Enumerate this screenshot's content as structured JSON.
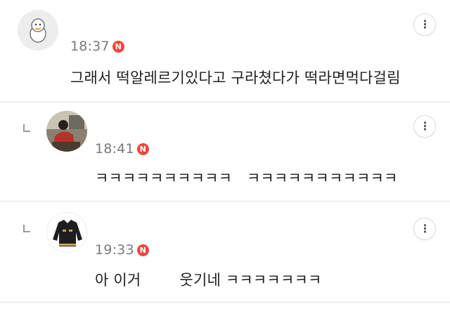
{
  "comments": [
    {
      "time": "18:37",
      "badge": "N",
      "text": "그래서 떡알레르기있다고 구라쳤다가 떡라면먹다걸림",
      "is_reply": false,
      "avatar": "cartoon-character"
    },
    {
      "time": "18:41",
      "badge": "N",
      "text": "ㅋㅋㅋㅋㅋㅋㅋㅋㅋㅋ   ㅋㅋㅋㅋㅋㅋㅋㅋㅋㅋㅋ",
      "is_reply": true,
      "avatar": "person-photo"
    },
    {
      "time": "19:33",
      "badge": "N",
      "text": "아 이거        웃기네 ㅋㅋㅋㅋㅋㅋㅋ",
      "is_reply": true,
      "avatar": "jacket-photo"
    }
  ],
  "more_label": "⋮",
  "colors": {
    "badge": "#f0473d",
    "time": "#7a7a7a",
    "divider": "#e4e4e4"
  }
}
